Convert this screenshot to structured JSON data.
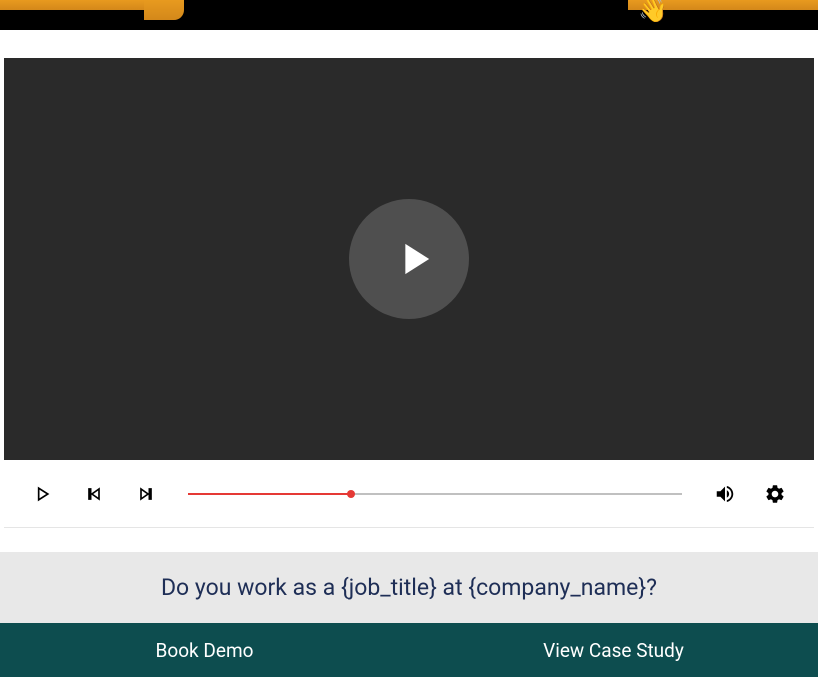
{
  "banner": {
    "wave_emoji": "👋"
  },
  "video": {
    "progress_percent": 33
  },
  "question": {
    "text": "Do you work as a {job_title} at {company_name}?"
  },
  "cta": {
    "book_demo": "Book Demo",
    "view_case_study": "View Case Study"
  }
}
